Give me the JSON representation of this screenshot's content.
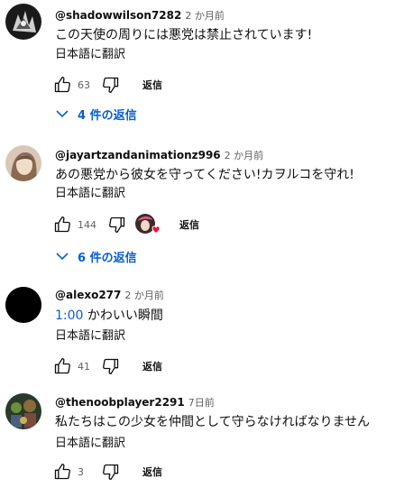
{
  "translate_label": "日本語に翻訳",
  "reply_label": "返信",
  "comments": [
    {
      "author": "@shadowwilson7282",
      "time": "2 か月前",
      "text": "この天使の周りには悪党は禁止されています!",
      "likes": "63",
      "replies_label": "4 件の返信"
    },
    {
      "author": "@jayartzandanimationz996",
      "time": "2 か月前",
      "text": "あの悪党から彼女を守ってください!カヲルコを守れ!",
      "likes": "144",
      "replies_label": "6 件の返信"
    },
    {
      "author": "@alexo277",
      "time": "2 か月前",
      "timestamp": "1:00",
      "text": "かわいい瞬間",
      "likes": "41"
    },
    {
      "author": "@thenoobplayer2291",
      "time": "7日前",
      "text": "私たちはこの少女を仲間として守らなければなりません",
      "likes": "3"
    }
  ],
  "colors": {
    "link_blue": "#065fd4",
    "meta_gray": "#606060",
    "heart_red": "#ff0033"
  }
}
